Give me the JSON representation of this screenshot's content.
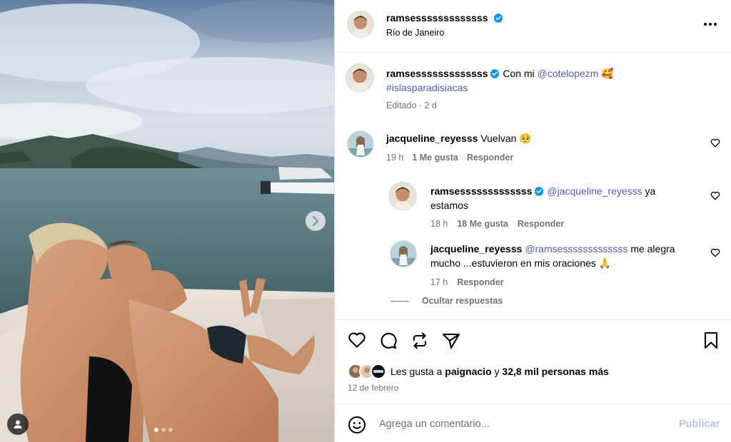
{
  "post": {
    "author": "ramsesssssssssssss",
    "location": "Río de Janeiro",
    "verified_color": "#0095f6"
  },
  "caption": {
    "author": "ramsesssssssssssss",
    "text_prefix": "Con mi",
    "mention": "@cotelopezm",
    "emoji": "🥰",
    "hashtag": "#islasparadisiacas",
    "meta": "Editado · 2 d"
  },
  "comments": [
    {
      "author": "jacqueline_reyesss",
      "text": "Vuelvan",
      "emoji": "🥺",
      "time": "19 h",
      "likes": "1 Me gusta",
      "reply": "Responder"
    }
  ],
  "replies": [
    {
      "author": "ramsesssssssssssss",
      "mention": "@jacqueline_reyesss",
      "text": "ya estamos",
      "time": "18 h",
      "likes": "18 Me gusta",
      "reply": "Responder"
    },
    {
      "author": "jacqueline_reyesss",
      "mention": "@ramsesssssssssssss",
      "text": "me alegra mucho ...estuvieron en mis oraciones",
      "emoji": "🙏",
      "time": "17 h",
      "reply": "Responder"
    }
  ],
  "hide_replies": "Ocultar respuestas",
  "likes": {
    "prefix": "Les gusta a",
    "user": "paignacio",
    "connector": "y",
    "others": "32,8 mil personas más"
  },
  "date": "12 de febrero",
  "composer": {
    "placeholder": "Agrega un comentario...",
    "publish": "Publicar"
  },
  "carousel": {
    "current": 1,
    "total": 3
  },
  "icons": {
    "like": "heart-icon",
    "comment": "comment-icon",
    "repost": "repost-icon",
    "share": "share-icon",
    "save": "bookmark-icon",
    "emoji": "emoji-icon",
    "more": "more-icon",
    "next": "chevron-right-icon",
    "tags": "user-tag-icon"
  },
  "colors": {
    "link": "#4a5fc1",
    "publish_disabled": "#b2c7f0",
    "muted": "#737373"
  }
}
